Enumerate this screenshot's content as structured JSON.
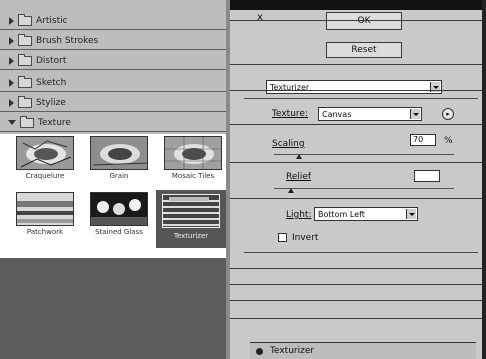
{
  "filter_gallery": {
    "categories": [
      {
        "label": "Artistic",
        "expanded": false
      },
      {
        "label": "Brush Strokes",
        "expanded": false
      },
      {
        "label": "Distort",
        "expanded": false
      },
      {
        "label": "Sketch",
        "expanded": false
      },
      {
        "label": "Stylize",
        "expanded": false
      },
      {
        "label": "Texture",
        "expanded": true
      }
    ],
    "thumbnails": [
      {
        "label": "Craquelure"
      },
      {
        "label": "Grain"
      },
      {
        "label": "Mosaic Tiles"
      },
      {
        "label": "Patchwork"
      },
      {
        "label": "Stained Glass"
      },
      {
        "label": "Texturizer"
      }
    ]
  },
  "top_bar": {
    "close_glyph": "x",
    "ok_label": "OK",
    "reset_label": "Reset"
  },
  "settings": {
    "filter_select": "Texturizer",
    "texture_label": "Texture:",
    "texture_value": "Canvas",
    "scaling_label": "Scaling",
    "scaling_value": "70",
    "scaling_unit": "%",
    "relief_label": "Relief",
    "relief_value": "",
    "light_label": "Light:",
    "light_value": "Bottom Left",
    "invert_label": "Invert"
  },
  "effect_layers": {
    "item_label": "Texturizer"
  }
}
